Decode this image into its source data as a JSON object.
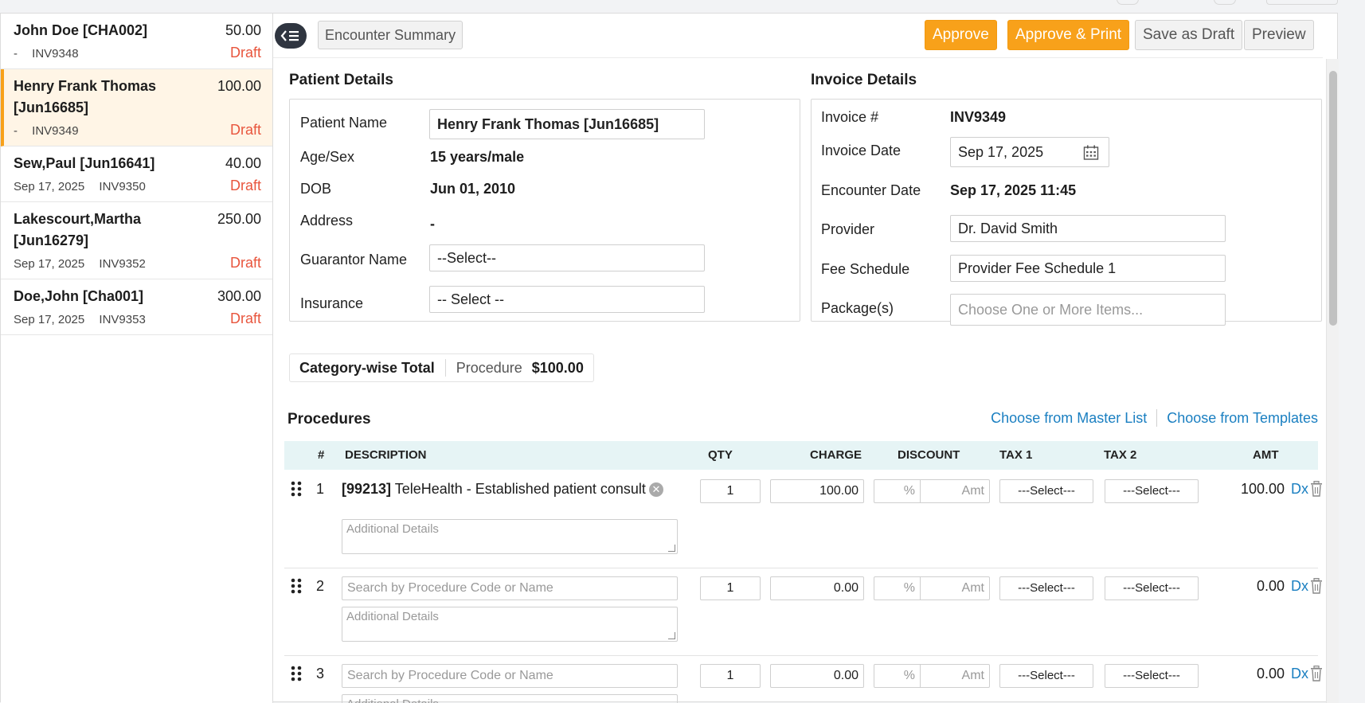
{
  "invoices": [
    {
      "name": "John Doe [CHA002]",
      "amount": "50.00",
      "date": "-",
      "invoice": "INV9348",
      "status": "Draft"
    },
    {
      "name": "Henry Frank Thomas [Jun16685]",
      "amount": "100.00",
      "date": "-",
      "invoice": "INV9349",
      "status": "Draft"
    },
    {
      "name": "Sew,Paul [Jun16641]",
      "amount": "40.00",
      "date": "Sep 17, 2025",
      "invoice": "INV9350",
      "status": "Draft"
    },
    {
      "name": "Lakescourt,Martha [Jun16279]",
      "amount": "250.00",
      "date": "Sep 17, 2025",
      "invoice": "INV9352",
      "status": "Draft"
    },
    {
      "name": "Doe,John [Cha001]",
      "amount": "300.00",
      "date": "Sep 17, 2025",
      "invoice": "INV9353",
      "status": "Draft"
    }
  ],
  "toolbar": {
    "encounter_summary": "Encounter Summary",
    "approve": "Approve",
    "approve_print": "Approve & Print",
    "save_draft": "Save as Draft",
    "preview": "Preview"
  },
  "patient": {
    "title": "Patient Details",
    "name_label": "Patient Name",
    "name_value": "Henry Frank Thomas [Jun16685]",
    "agesex_label": "Age/Sex",
    "agesex_value": "15 years/male",
    "dob_label": "DOB",
    "dob_value": "Jun 01, 2010",
    "address_label": "Address",
    "address_value": "-",
    "guarantor_label": "Guarantor Name",
    "guarantor_value": "--Select--",
    "insurance_label": "Insurance",
    "insurance_value": "-- Select --"
  },
  "invoice_details": {
    "title": "Invoice Details",
    "number_label": "Invoice #",
    "number_value": "INV9349",
    "date_label": "Invoice Date",
    "date_value": "Sep 17, 2025",
    "encounter_label": "Encounter Date",
    "encounter_value": "Sep 17, 2025 11:45",
    "provider_label": "Provider",
    "provider_value": "Dr. David Smith",
    "fee_label": "Fee Schedule",
    "fee_value": "Provider Fee Schedule 1",
    "package_label": "Package(s)",
    "package_placeholder": "Choose One or More Items..."
  },
  "category_total": {
    "label": "Category-wise Total",
    "category": "Procedure",
    "value": "$100.00"
  },
  "procedures": {
    "title": "Procedures",
    "master_list": "Choose from Master List",
    "templates": "Choose from Templates",
    "headers": {
      "num": "#",
      "description": "DESCRIPTION",
      "qty": "QTY",
      "charge": "CHARGE",
      "discount": "DISCOUNT",
      "tax1": "TAX 1",
      "tax2": "TAX 2",
      "amt": "AMT"
    },
    "search_placeholder": "Search by Procedure Code or Name",
    "additional_placeholder": "Additional Details",
    "pct_placeholder": "%",
    "amt_placeholder": "Amt",
    "dx": "Dx",
    "rows": [
      {
        "num": "1",
        "code": "[99213]",
        "desc": "TeleHealth - Established patient consult",
        "qty": "1",
        "charge": "100.00",
        "tax1": "---Select---",
        "tax2": "---Select---",
        "amount": "100.00"
      },
      {
        "num": "2",
        "qty": "1",
        "charge": "0.00",
        "tax1": "---Select---",
        "tax2": "---Select---",
        "amount": "0.00"
      },
      {
        "num": "3",
        "qty": "1",
        "charge": "0.00",
        "tax1": "---Select---",
        "tax2": "---Select---",
        "amount": "0.00"
      }
    ]
  }
}
